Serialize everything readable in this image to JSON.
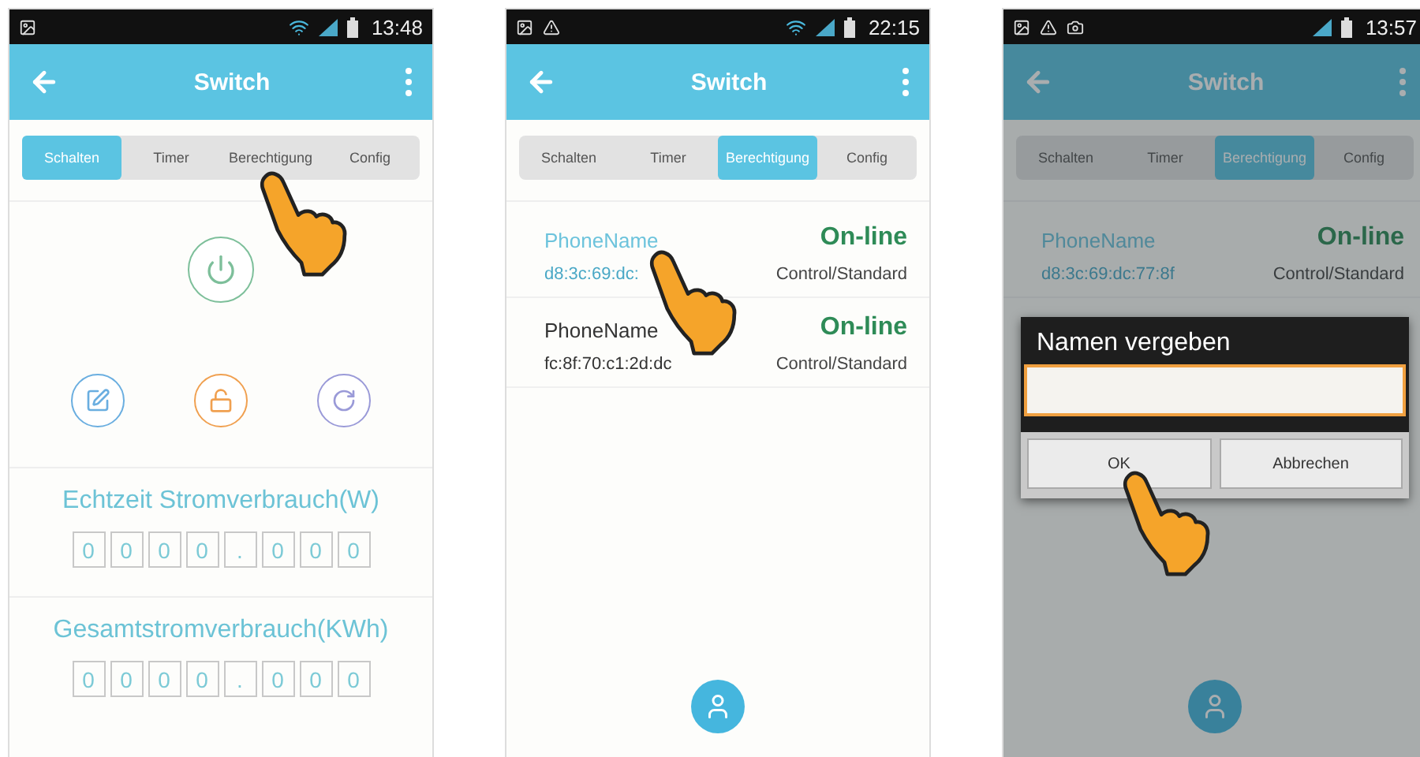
{
  "phones": [
    {
      "kind": "switch",
      "dimmed": false,
      "status_bar": {
        "time": "13:48",
        "wifi": true,
        "notifications": [
          {
            "kind": "image"
          }
        ]
      },
      "app_bar": {
        "title": "Switch"
      },
      "tabs": [
        {
          "label": "Schalten",
          "selected": true,
          "touched": false
        },
        {
          "label": "Timer",
          "selected": false,
          "touched": false
        },
        {
          "label": "Berechtigung",
          "selected": false,
          "touched": true
        },
        {
          "label": "Config",
          "selected": false,
          "touched": false
        }
      ],
      "meters": [
        {
          "label": "Echtzeit Stromverbrauch(W)",
          "digits": [
            "0",
            "0",
            "0",
            "0",
            ".",
            "0",
            "0",
            "0"
          ]
        },
        {
          "label": "Gesamtstromverbrauch(KWh)",
          "digits": [
            "0",
            "0",
            "0",
            "0",
            ".",
            "0",
            "0",
            "0"
          ]
        }
      ]
    },
    {
      "kind": "permissions",
      "dimmed": false,
      "status_bar": {
        "time": "22:15",
        "wifi": true,
        "notifications": [
          {
            "kind": "image"
          },
          {
            "kind": "warning"
          }
        ]
      },
      "app_bar": {
        "title": "Switch"
      },
      "tabs": [
        {
          "label": "Schalten",
          "selected": false,
          "touched": false
        },
        {
          "label": "Timer",
          "selected": false,
          "touched": false
        },
        {
          "label": "Berechtigung",
          "selected": true,
          "touched": false
        },
        {
          "label": "Config",
          "selected": false,
          "touched": false
        }
      ],
      "devices": [
        {
          "name": "PhoneName",
          "mac": "d8:3c:69:dc:",
          "status": "On-line",
          "role": "Control/Standard",
          "selected": true,
          "touched": true
        },
        {
          "name": "PhoneName",
          "mac": "fc:8f:70:c1:2d:dc",
          "status": "On-line",
          "role": "Control/Standard",
          "selected": false,
          "touched": false
        }
      ]
    },
    {
      "kind": "permissions",
      "dimmed": true,
      "status_bar": {
        "time": "13:57",
        "wifi": false,
        "notifications": [
          {
            "kind": "image"
          },
          {
            "kind": "warning"
          },
          {
            "kind": "camera"
          }
        ]
      },
      "app_bar": {
        "title": "Switch"
      },
      "tabs": [
        {
          "label": "Schalten",
          "selected": false,
          "touched": false
        },
        {
          "label": "Timer",
          "selected": false,
          "touched": false
        },
        {
          "label": "Berechtigung",
          "selected": true,
          "touched": false
        },
        {
          "label": "Config",
          "selected": false,
          "touched": false
        }
      ],
      "devices": [
        {
          "name": "PhoneName",
          "mac": "d8:3c:69:dc:77:8f",
          "status": "On-line",
          "role": "Control/Standard",
          "selected": true,
          "touched": false
        }
      ],
      "dialog": {
        "title": "Namen vergeben",
        "buttons": [
          {
            "label": "OK",
            "touched": true
          },
          {
            "label": "Abbrechen",
            "touched": false
          }
        ]
      }
    }
  ]
}
